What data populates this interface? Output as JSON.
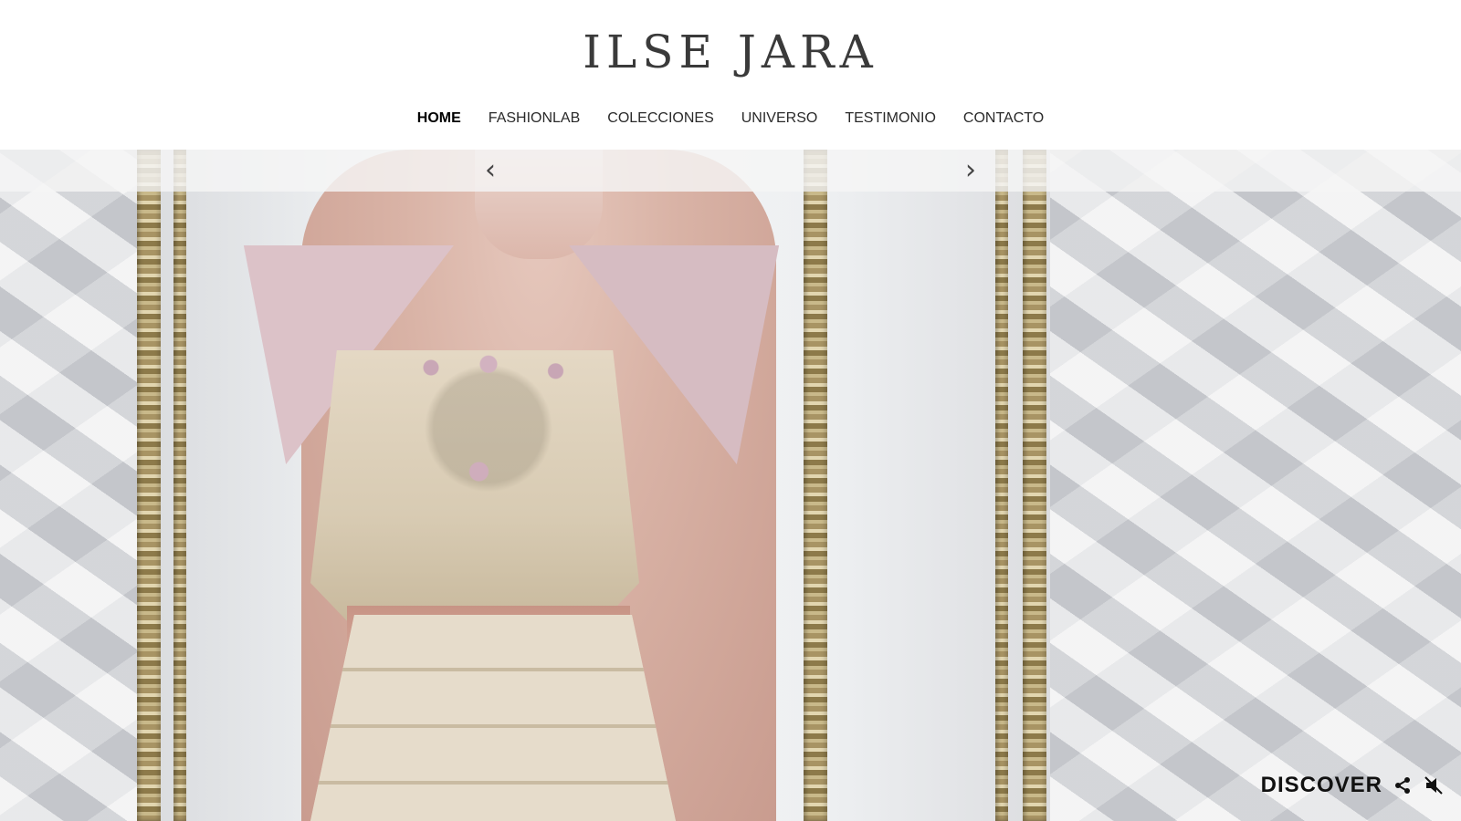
{
  "brand": {
    "logo_text": "ILSE JARA"
  },
  "nav": {
    "items": [
      {
        "label": "HOME",
        "active": true
      },
      {
        "label": "FASHIONLAB",
        "active": false
      },
      {
        "label": "COLECCIONES",
        "active": false
      },
      {
        "label": "UNIVERSO",
        "active": false
      },
      {
        "label": "TESTIMONIO",
        "active": false
      },
      {
        "label": "CONTACTO",
        "active": false
      }
    ]
  },
  "slider": {
    "prev_icon": "chevron-left-icon",
    "next_icon": "chevron-right-icon",
    "prev_glyph": "‹",
    "next_glyph": "›"
  },
  "footer": {
    "discover_label": "DISCOVER",
    "share_icon": "share-icon",
    "mute_icon": "speaker-muted-icon"
  },
  "colors": {
    "text_primary": "#2a2a2a",
    "background": "#ffffff"
  }
}
